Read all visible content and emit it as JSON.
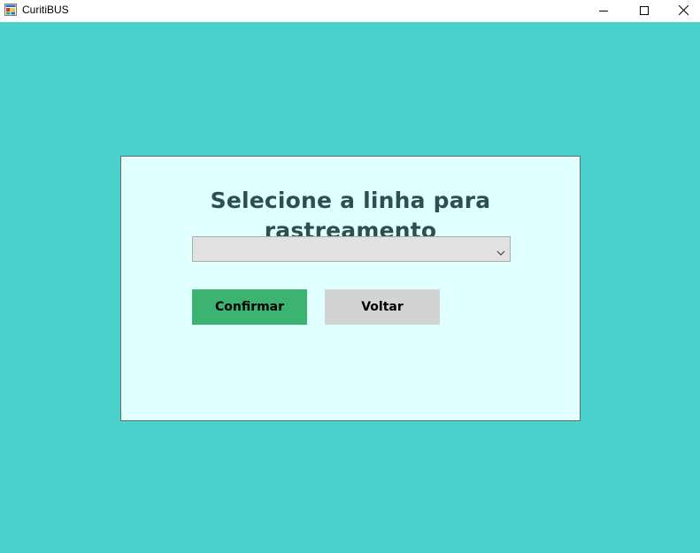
{
  "window": {
    "title": "CuritiBUS",
    "icon": "app-window-icon",
    "controls": [
      "minimize-icon",
      "maximize-icon",
      "close-icon"
    ]
  },
  "colors": {
    "background": "#4bd1cc",
    "panel": "#e0ffff",
    "heading": "#2f4f4f",
    "confirm_button": "#3cb371",
    "back_button": "#d3d3d3",
    "combo": "#e1e1e1"
  },
  "panel": {
    "heading": "Selecione a linha para rastreamento",
    "line_select": {
      "value": "",
      "icon": "chevron-down-icon"
    },
    "confirm_label": "Confirmar",
    "back_label": "Voltar"
  }
}
